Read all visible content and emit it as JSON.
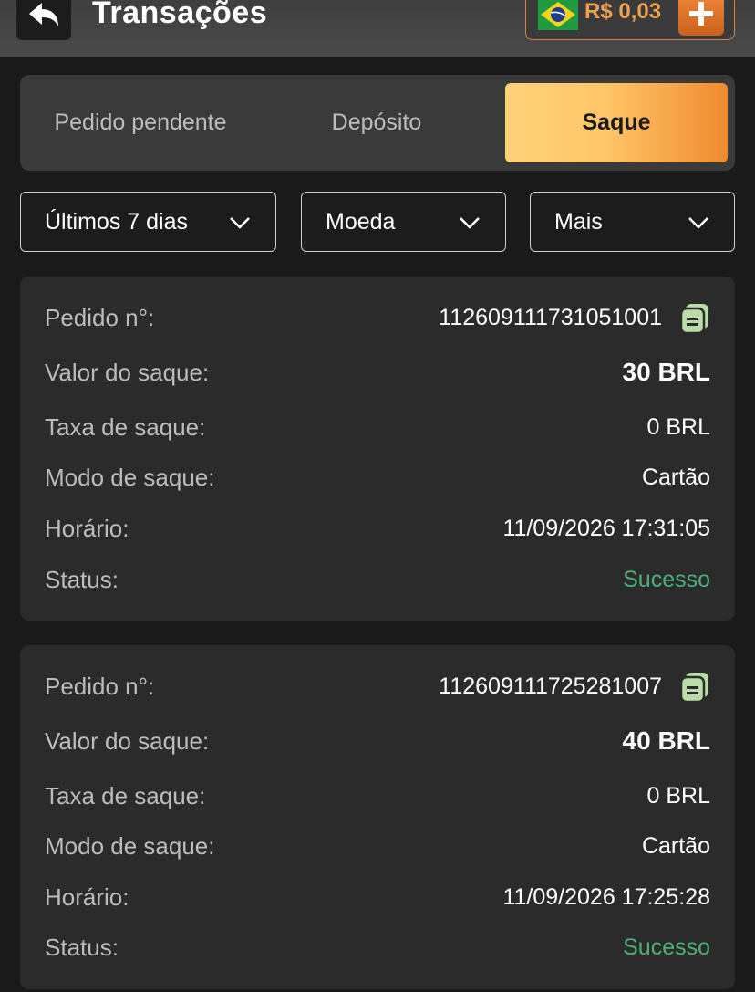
{
  "header": {
    "title": "Transações",
    "balance": "R$ 0,03"
  },
  "tabs": [
    {
      "label": "Pedido pendente",
      "active": false
    },
    {
      "label": "Depósito",
      "active": false
    },
    {
      "label": "Saque",
      "active": true
    }
  ],
  "filters": [
    {
      "label": "Últimos 7 dias"
    },
    {
      "label": "Moeda"
    },
    {
      "label": "Mais"
    }
  ],
  "labels": {
    "order": "Pedido n°:",
    "amount": "Valor do saque:",
    "fee": "Taxa de saque:",
    "mode": "Modo de saque:",
    "time": "Horário:",
    "status": "Status:"
  },
  "transactions": [
    {
      "order": "112609111731051001",
      "amount": "30 BRL",
      "fee": "0 BRL",
      "mode": "Cartão",
      "time": "11/09/2026 17:31:05",
      "status": "Sucesso"
    },
    {
      "order": "112609111725281007",
      "amount": "40 BRL",
      "fee": "0 BRL",
      "mode": "Cartão",
      "time": "11/09/2026 17:25:28",
      "status": "Sucesso"
    }
  ],
  "colors": {
    "accent": "#f08a30",
    "success": "#4caf7a",
    "background": "#1a1a1a",
    "card": "#2b2b2b"
  },
  "icons": {
    "back": "back-arrow-icon",
    "flag": "brazil-flag-icon",
    "add": "plus-icon",
    "chevron": "chevron-down-icon",
    "copy": "copy-icon"
  }
}
